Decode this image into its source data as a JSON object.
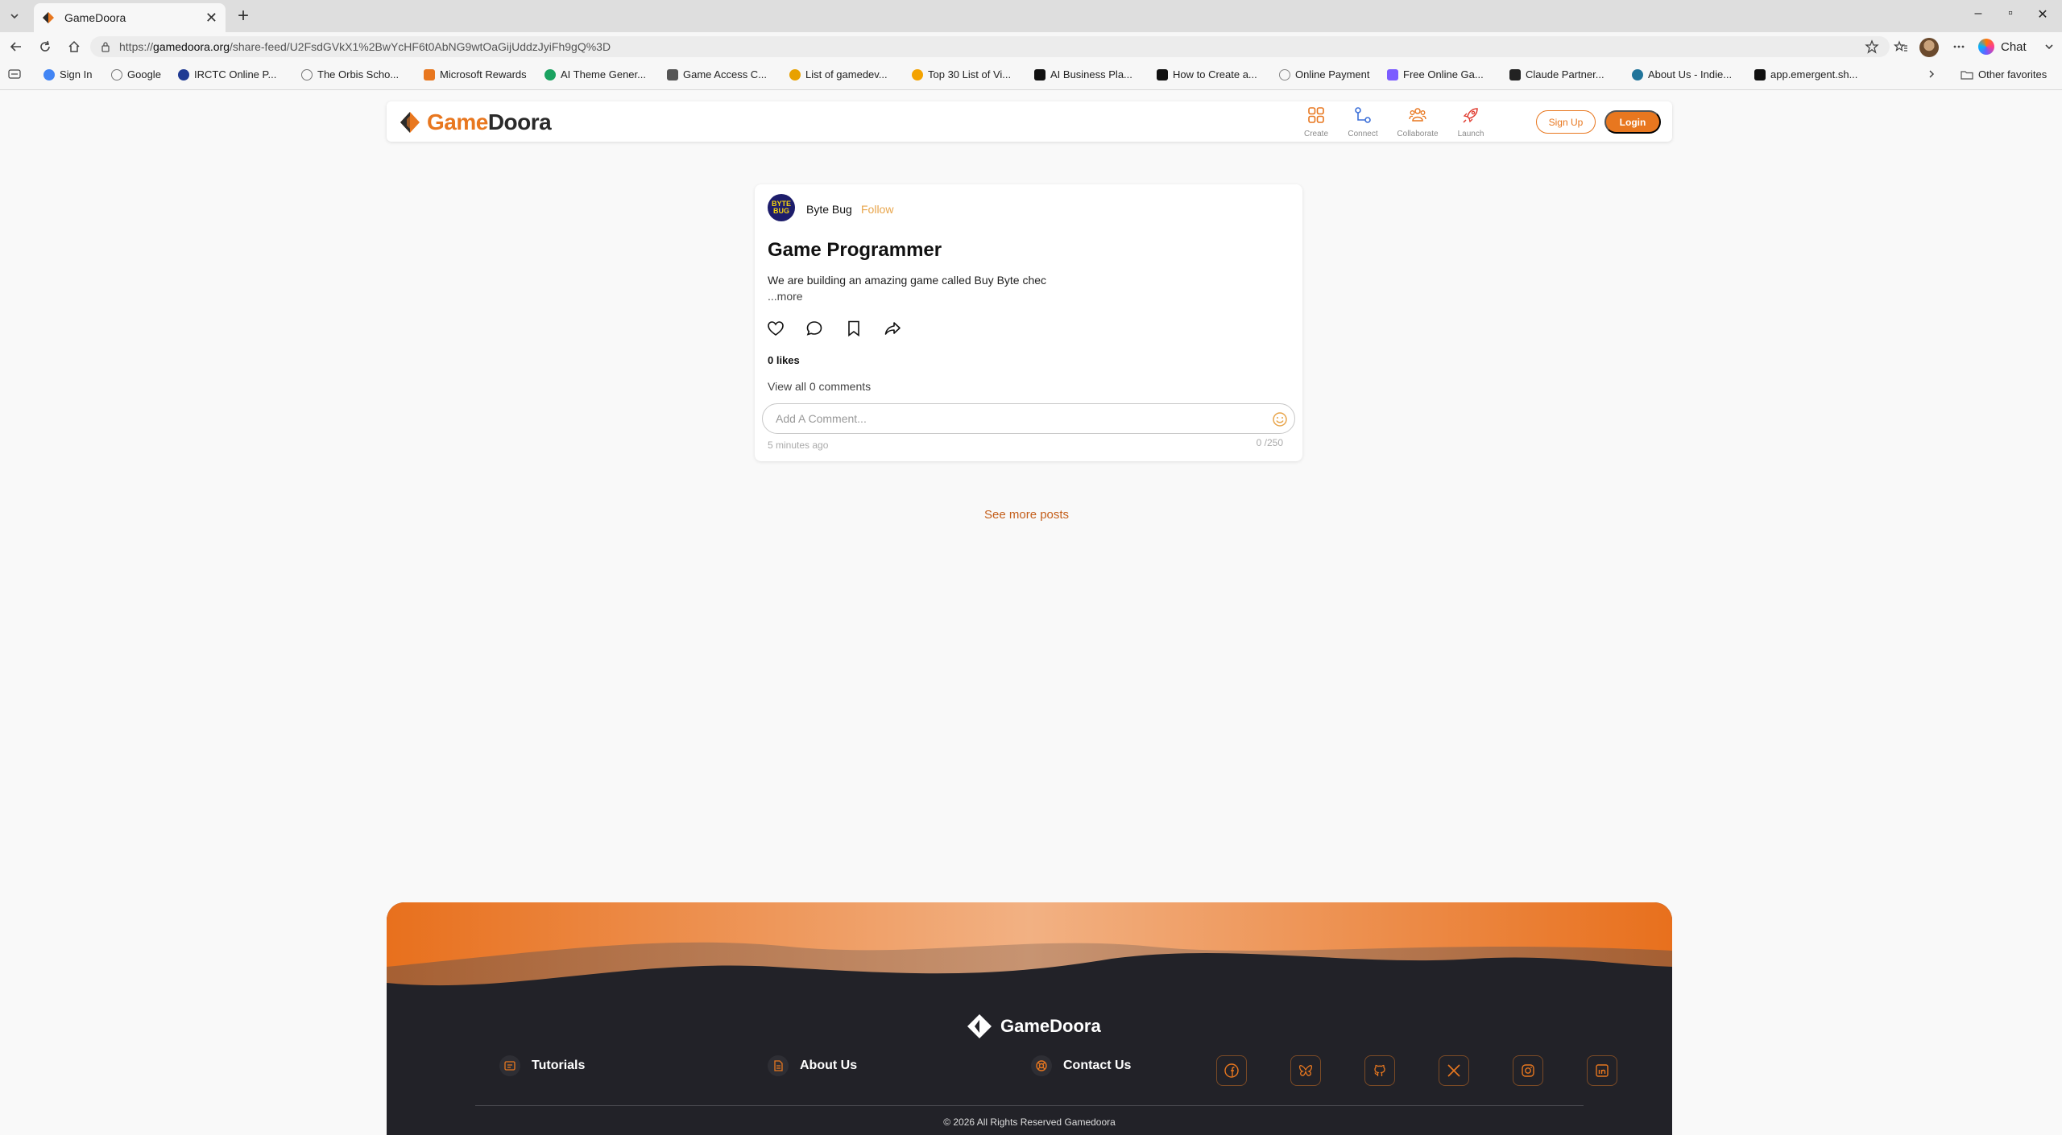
{
  "browser": {
    "tab_title": "GameDoora",
    "url_scheme": "https://",
    "url_host": "gamedoora.org",
    "url_path": "/share-feed/U2FsdGVkX1%2BwYcHF6t0AbNG9wtOaGijUddzJyiFh9gQ%3D",
    "chat_label": "Chat",
    "bookmarks": [
      {
        "label": "Sign In",
        "icon": "google-sign-in-icon",
        "color": "#4285f4"
      },
      {
        "label": "Google",
        "icon": "globe-icon",
        "color": "#777777"
      },
      {
        "label": "IRCTC Online P...",
        "icon": "irctc-icon",
        "color": "#1f3a93"
      },
      {
        "label": "The Orbis Scho...",
        "icon": "globe-icon",
        "color": "#777777"
      },
      {
        "label": "Microsoft Rewards",
        "icon": "rewards-icon",
        "color": "#e8771f"
      },
      {
        "label": "AI Theme Gener...",
        "icon": "edge-icon",
        "color": "#1aa260"
      },
      {
        "label": "Game Access C...",
        "icon": "gamepad-icon",
        "color": "#555555"
      },
      {
        "label": "List of gamedev...",
        "icon": "list-icon",
        "color": "#e8a100"
      },
      {
        "label": "Top 30 List of Vi...",
        "icon": "bulb-icon",
        "color": "#f4a300"
      },
      {
        "label": "AI Business Pla...",
        "icon": "p-icon",
        "color": "#111111"
      },
      {
        "label": "How to Create a...",
        "icon": "a-icon",
        "color": "#111111"
      },
      {
        "label": "Online Payment",
        "icon": "payment-icon",
        "color": "#888888"
      },
      {
        "label": "Free Online Ga...",
        "icon": "game-icon",
        "color": "#7b5cff"
      },
      {
        "label": "Claude Partner...",
        "icon": "anthropic-icon",
        "color": "#222222"
      },
      {
        "label": "About Us - Indie...",
        "icon": "wordpress-icon",
        "color": "#21759b"
      },
      {
        "label": "app.emergent.sh...",
        "icon": "emergent-icon",
        "color": "#111111"
      }
    ],
    "other_favorites": "Other favorites"
  },
  "header": {
    "logo_part1": "Game",
    "logo_part2": "Doora",
    "nav": [
      {
        "label": "Create",
        "icon": "grid-icon",
        "color": "#e8771f"
      },
      {
        "label": "Connect",
        "icon": "connect-icon",
        "color": "#3b6fd8"
      },
      {
        "label": "Collaborate",
        "icon": "people-icon",
        "color": "#e8771f"
      },
      {
        "label": "Launch",
        "icon": "rocket-icon",
        "color": "#e03b2f"
      }
    ],
    "signup_label": "Sign Up",
    "login_label": "Login"
  },
  "post": {
    "avatar_text": "BYTE BUG",
    "author": "Byte Bug",
    "follow_label": "Follow",
    "title": "Game Programmer",
    "body": "We are building an amazing game called Buy Byte chec",
    "more_label": "...more",
    "likes": "0 likes",
    "view_comments": "View all 0 comments",
    "comment_placeholder": "Add A Comment...",
    "time": "5 minutes ago",
    "char_count": "0 /250"
  },
  "see_more_label": "See more posts",
  "footer": {
    "logo_text": "GameDoora",
    "links": [
      {
        "label": "Tutorials",
        "icon": "tutorials-icon"
      },
      {
        "label": "About Us",
        "icon": "document-icon"
      },
      {
        "label": "Contact Us",
        "icon": "support-icon"
      }
    ],
    "socials": [
      "facebook-icon",
      "bluesky-icon",
      "github-icon",
      "x-icon",
      "instagram-icon",
      "linkedin-icon"
    ],
    "copyright": "© 2026 All Rights Reserved Gamedoora"
  },
  "colors": {
    "brand_orange": "#e8771f",
    "footer_dark": "#222228",
    "link_orange": "#c45e1a"
  }
}
